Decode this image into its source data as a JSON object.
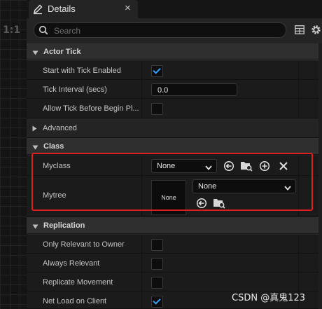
{
  "viewport": {
    "ratio_label": "1:1"
  },
  "tab": {
    "title": "Details",
    "close_label": "×"
  },
  "search": {
    "placeholder": "Search"
  },
  "sections": {
    "actor_tick": "Actor Tick",
    "advanced": "Advanced",
    "class": "Class",
    "replication": "Replication"
  },
  "actor_tick": {
    "start_with_tick": {
      "label": "Start with Tick Enabled",
      "checked": true
    },
    "tick_interval": {
      "label": "Tick Interval (secs)",
      "value": "0.0"
    },
    "allow_tick": {
      "label": "Allow Tick Before Begin Pl...",
      "checked": false
    }
  },
  "class_props": {
    "myclass": {
      "label": "Myclass",
      "value": "None"
    },
    "mytree": {
      "label": "Mytree",
      "value": "None",
      "thumbnail": "None"
    }
  },
  "replication": {
    "only_relevant": {
      "label": "Only Relevant to Owner",
      "checked": false
    },
    "always_relevant": {
      "label": "Always Relevant",
      "checked": false
    },
    "replicate_movement": {
      "label": "Replicate Movement",
      "checked": false
    },
    "net_load": {
      "label": "Net Load on Client",
      "checked": true
    }
  },
  "colors": {
    "highlight_border": "#e02020",
    "check_accent": "#3aa0ff"
  },
  "watermark": "CSDN @真鬼123"
}
